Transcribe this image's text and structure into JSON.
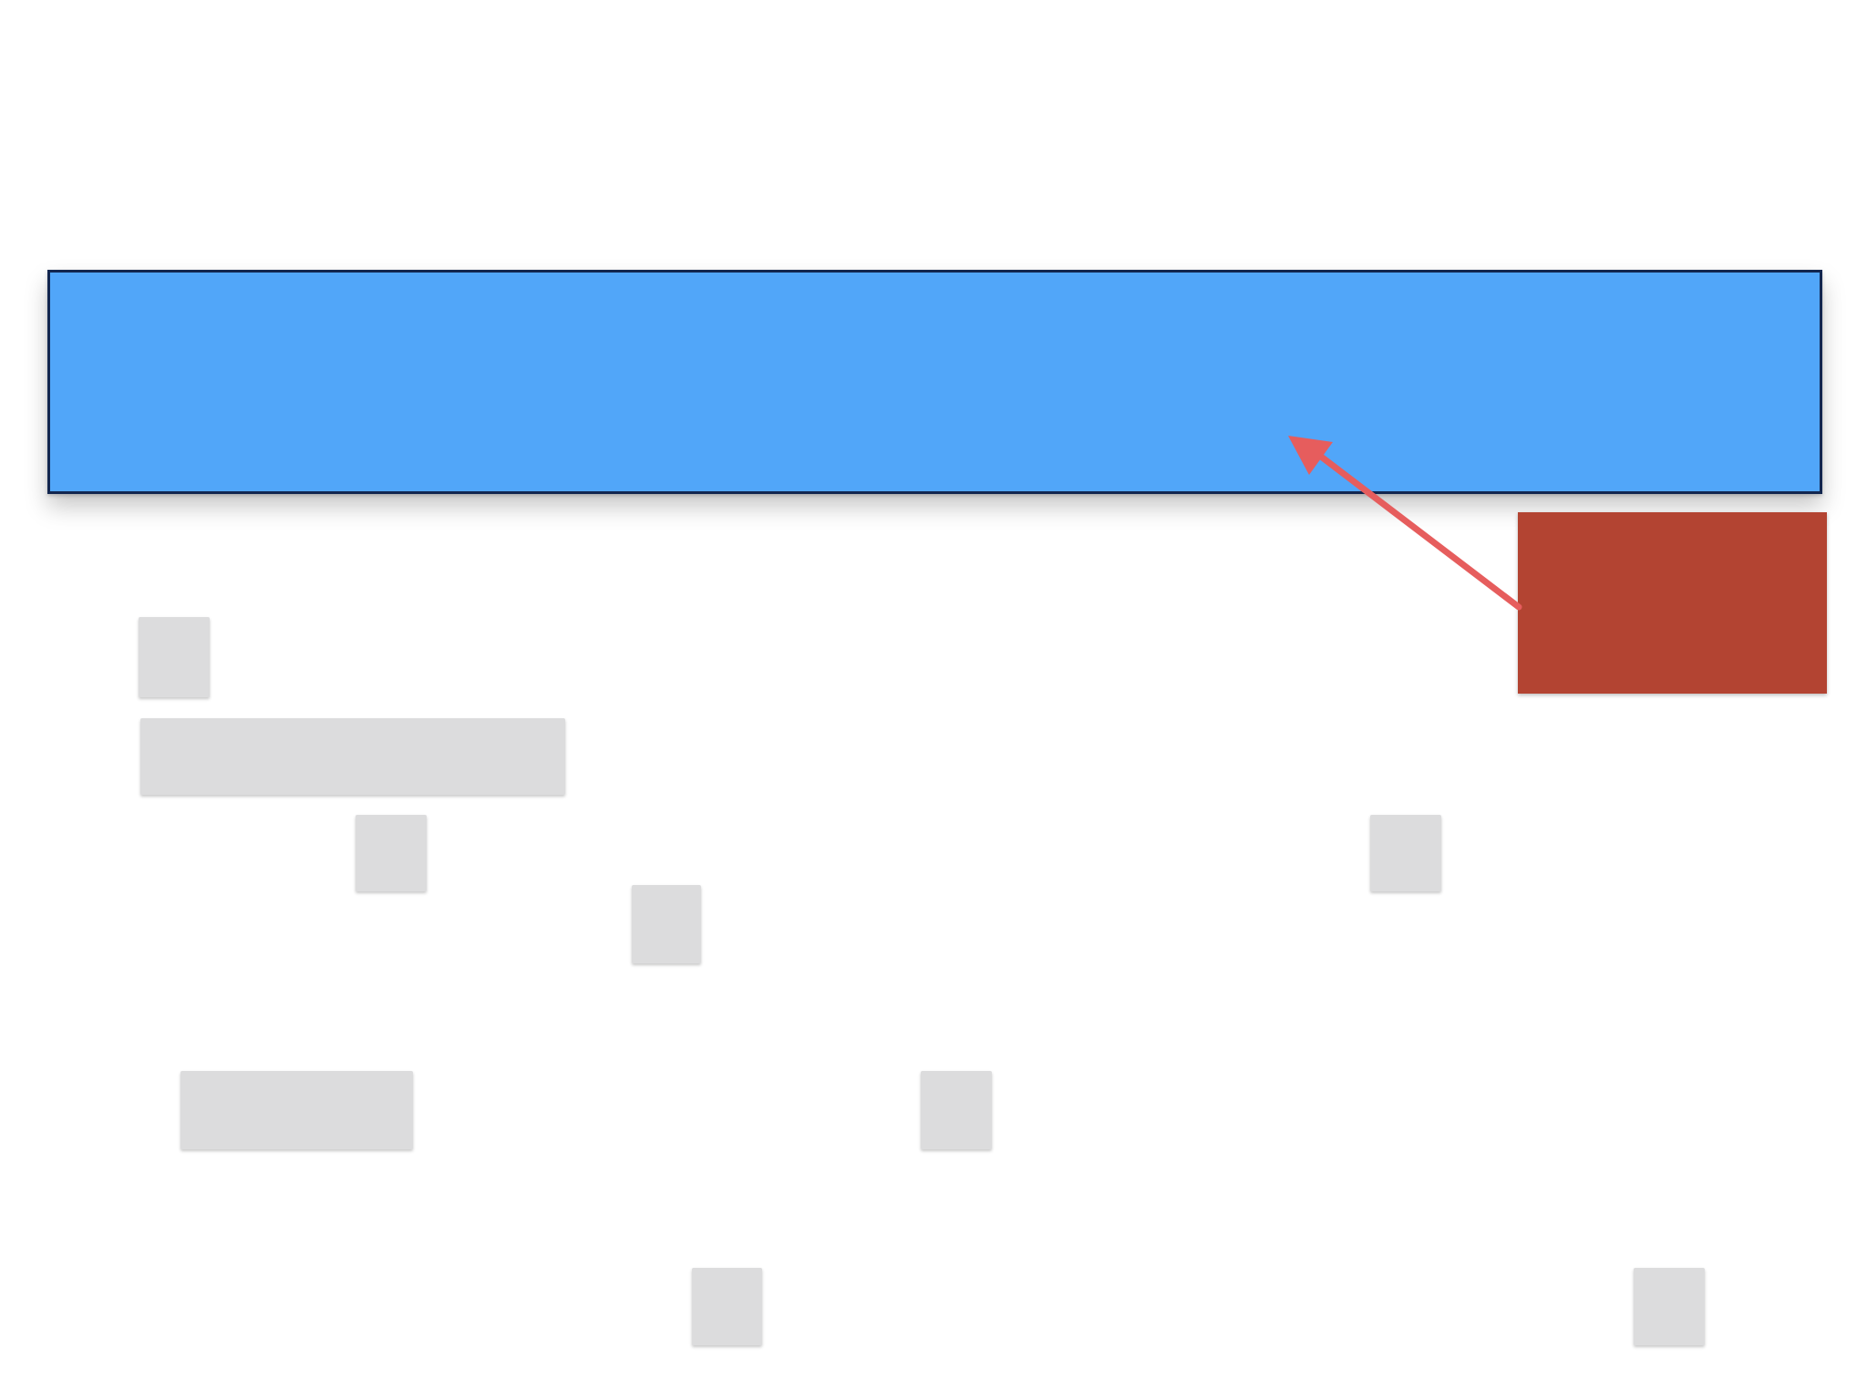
{
  "canvas": {
    "background": "#ffffff"
  },
  "colors": {
    "banner_fill": "#51a6f9",
    "banner_border": "#12264f",
    "note_fill": "#b34432",
    "block_fill": "#dcdcdd",
    "arrow_stroke": "#e65d5d"
  },
  "diagram": {
    "banner": {
      "text": ""
    },
    "note": {
      "text": ""
    },
    "placeholder_block_count": 10,
    "connector": {
      "from": "note",
      "to": "banner",
      "head": "arrow"
    }
  }
}
